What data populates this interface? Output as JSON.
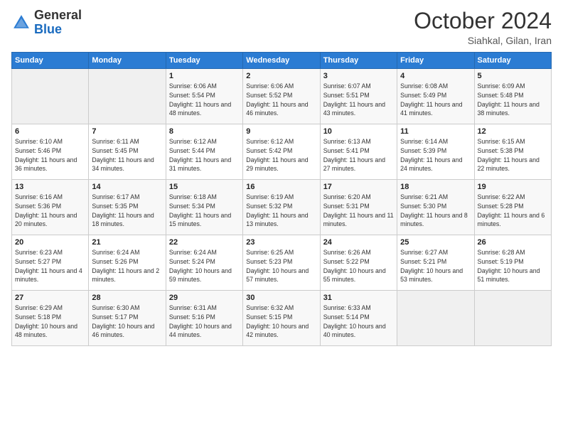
{
  "header": {
    "logo_general": "General",
    "logo_blue": "Blue",
    "month": "October 2024",
    "location": "Siahkal, Gilan, Iran"
  },
  "weekdays": [
    "Sunday",
    "Monday",
    "Tuesday",
    "Wednesday",
    "Thursday",
    "Friday",
    "Saturday"
  ],
  "weeks": [
    [
      {
        "day": "",
        "sunrise": "",
        "sunset": "",
        "daylight": ""
      },
      {
        "day": "",
        "sunrise": "",
        "sunset": "",
        "daylight": ""
      },
      {
        "day": "1",
        "sunrise": "Sunrise: 6:06 AM",
        "sunset": "Sunset: 5:54 PM",
        "daylight": "Daylight: 11 hours and 48 minutes."
      },
      {
        "day": "2",
        "sunrise": "Sunrise: 6:06 AM",
        "sunset": "Sunset: 5:52 PM",
        "daylight": "Daylight: 11 hours and 46 minutes."
      },
      {
        "day": "3",
        "sunrise": "Sunrise: 6:07 AM",
        "sunset": "Sunset: 5:51 PM",
        "daylight": "Daylight: 11 hours and 43 minutes."
      },
      {
        "day": "4",
        "sunrise": "Sunrise: 6:08 AM",
        "sunset": "Sunset: 5:49 PM",
        "daylight": "Daylight: 11 hours and 41 minutes."
      },
      {
        "day": "5",
        "sunrise": "Sunrise: 6:09 AM",
        "sunset": "Sunset: 5:48 PM",
        "daylight": "Daylight: 11 hours and 38 minutes."
      }
    ],
    [
      {
        "day": "6",
        "sunrise": "Sunrise: 6:10 AM",
        "sunset": "Sunset: 5:46 PM",
        "daylight": "Daylight: 11 hours and 36 minutes."
      },
      {
        "day": "7",
        "sunrise": "Sunrise: 6:11 AM",
        "sunset": "Sunset: 5:45 PM",
        "daylight": "Daylight: 11 hours and 34 minutes."
      },
      {
        "day": "8",
        "sunrise": "Sunrise: 6:12 AM",
        "sunset": "Sunset: 5:44 PM",
        "daylight": "Daylight: 11 hours and 31 minutes."
      },
      {
        "day": "9",
        "sunrise": "Sunrise: 6:12 AM",
        "sunset": "Sunset: 5:42 PM",
        "daylight": "Daylight: 11 hours and 29 minutes."
      },
      {
        "day": "10",
        "sunrise": "Sunrise: 6:13 AM",
        "sunset": "Sunset: 5:41 PM",
        "daylight": "Daylight: 11 hours and 27 minutes."
      },
      {
        "day": "11",
        "sunrise": "Sunrise: 6:14 AM",
        "sunset": "Sunset: 5:39 PM",
        "daylight": "Daylight: 11 hours and 24 minutes."
      },
      {
        "day": "12",
        "sunrise": "Sunrise: 6:15 AM",
        "sunset": "Sunset: 5:38 PM",
        "daylight": "Daylight: 11 hours and 22 minutes."
      }
    ],
    [
      {
        "day": "13",
        "sunrise": "Sunrise: 6:16 AM",
        "sunset": "Sunset: 5:36 PM",
        "daylight": "Daylight: 11 hours and 20 minutes."
      },
      {
        "day": "14",
        "sunrise": "Sunrise: 6:17 AM",
        "sunset": "Sunset: 5:35 PM",
        "daylight": "Daylight: 11 hours and 18 minutes."
      },
      {
        "day": "15",
        "sunrise": "Sunrise: 6:18 AM",
        "sunset": "Sunset: 5:34 PM",
        "daylight": "Daylight: 11 hours and 15 minutes."
      },
      {
        "day": "16",
        "sunrise": "Sunrise: 6:19 AM",
        "sunset": "Sunset: 5:32 PM",
        "daylight": "Daylight: 11 hours and 13 minutes."
      },
      {
        "day": "17",
        "sunrise": "Sunrise: 6:20 AM",
        "sunset": "Sunset: 5:31 PM",
        "daylight": "Daylight: 11 hours and 11 minutes."
      },
      {
        "day": "18",
        "sunrise": "Sunrise: 6:21 AM",
        "sunset": "Sunset: 5:30 PM",
        "daylight": "Daylight: 11 hours and 8 minutes."
      },
      {
        "day": "19",
        "sunrise": "Sunrise: 6:22 AM",
        "sunset": "Sunset: 5:28 PM",
        "daylight": "Daylight: 11 hours and 6 minutes."
      }
    ],
    [
      {
        "day": "20",
        "sunrise": "Sunrise: 6:23 AM",
        "sunset": "Sunset: 5:27 PM",
        "daylight": "Daylight: 11 hours and 4 minutes."
      },
      {
        "day": "21",
        "sunrise": "Sunrise: 6:24 AM",
        "sunset": "Sunset: 5:26 PM",
        "daylight": "Daylight: 11 hours and 2 minutes."
      },
      {
        "day": "22",
        "sunrise": "Sunrise: 6:24 AM",
        "sunset": "Sunset: 5:24 PM",
        "daylight": "Daylight: 10 hours and 59 minutes."
      },
      {
        "day": "23",
        "sunrise": "Sunrise: 6:25 AM",
        "sunset": "Sunset: 5:23 PM",
        "daylight": "Daylight: 10 hours and 57 minutes."
      },
      {
        "day": "24",
        "sunrise": "Sunrise: 6:26 AM",
        "sunset": "Sunset: 5:22 PM",
        "daylight": "Daylight: 10 hours and 55 minutes."
      },
      {
        "day": "25",
        "sunrise": "Sunrise: 6:27 AM",
        "sunset": "Sunset: 5:21 PM",
        "daylight": "Daylight: 10 hours and 53 minutes."
      },
      {
        "day": "26",
        "sunrise": "Sunrise: 6:28 AM",
        "sunset": "Sunset: 5:19 PM",
        "daylight": "Daylight: 10 hours and 51 minutes."
      }
    ],
    [
      {
        "day": "27",
        "sunrise": "Sunrise: 6:29 AM",
        "sunset": "Sunset: 5:18 PM",
        "daylight": "Daylight: 10 hours and 48 minutes."
      },
      {
        "day": "28",
        "sunrise": "Sunrise: 6:30 AM",
        "sunset": "Sunset: 5:17 PM",
        "daylight": "Daylight: 10 hours and 46 minutes."
      },
      {
        "day": "29",
        "sunrise": "Sunrise: 6:31 AM",
        "sunset": "Sunset: 5:16 PM",
        "daylight": "Daylight: 10 hours and 44 minutes."
      },
      {
        "day": "30",
        "sunrise": "Sunrise: 6:32 AM",
        "sunset": "Sunset: 5:15 PM",
        "daylight": "Daylight: 10 hours and 42 minutes."
      },
      {
        "day": "31",
        "sunrise": "Sunrise: 6:33 AM",
        "sunset": "Sunset: 5:14 PM",
        "daylight": "Daylight: 10 hours and 40 minutes."
      },
      {
        "day": "",
        "sunrise": "",
        "sunset": "",
        "daylight": ""
      },
      {
        "day": "",
        "sunrise": "",
        "sunset": "",
        "daylight": ""
      }
    ]
  ]
}
